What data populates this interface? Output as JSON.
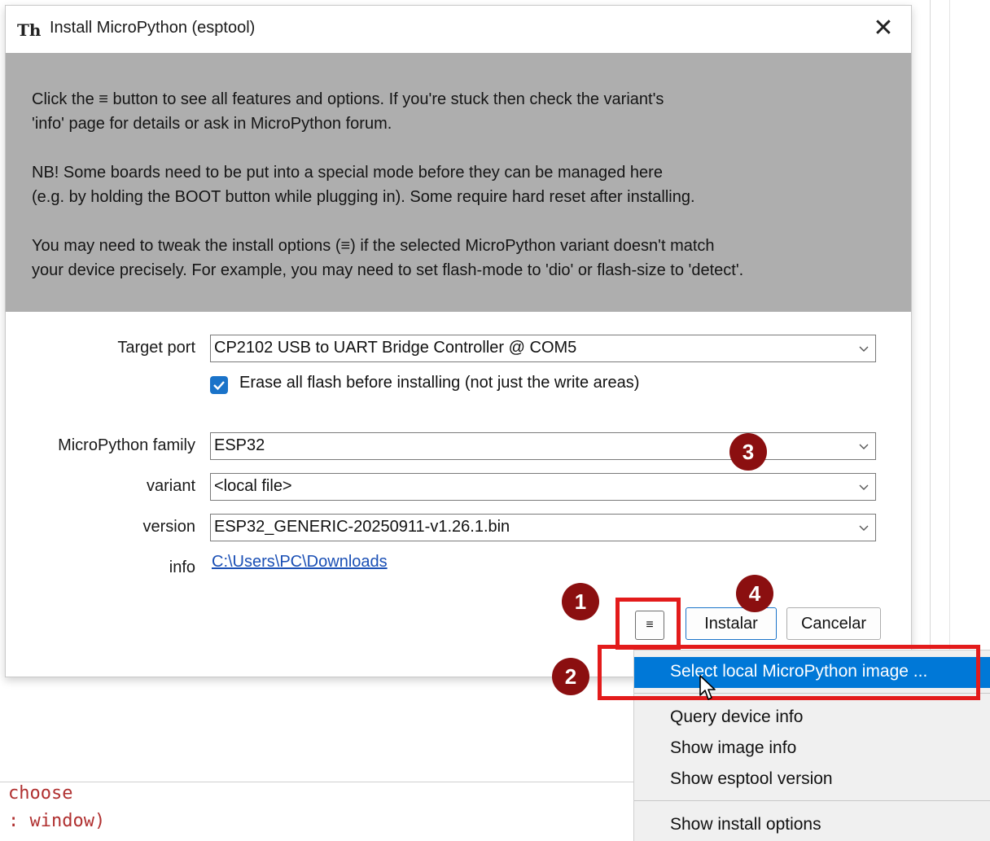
{
  "dialog": {
    "title": "Install MicroPython (esptool)",
    "close_glyph": "✕",
    "info_text": {
      "p1_line1": "Click the ≡ button to see all features and options. If you're stuck then check the variant's",
      "p1_line2": "'info' page for details or ask in MicroPython forum.",
      "p2_line1": "NB! Some boards need to be put into a special mode before they can be managed here",
      "p2_line2": "(e.g. by holding the BOOT button while plugging in). Some require hard reset after installing.",
      "p3_line1": "You may need to tweak the install options (≡) if the selected MicroPython variant doesn't match",
      "p3_line2": "your device precisely. For example, you may need to set flash-mode to 'dio' or flash-size to 'detect'."
    },
    "form": {
      "target_port_label": "Target port",
      "target_port_value": "CP2102 USB to UART Bridge Controller @ COM5",
      "erase_label": "Erase all flash before installing (not just the write areas)",
      "erase_checked": true,
      "family_label": "MicroPython family",
      "family_value": "ESP32",
      "variant_label": "variant",
      "variant_value": "<local file>",
      "version_label": "version",
      "version_value": "ESP32_GENERIC-20250911-v1.26.1.bin",
      "info_label": "info",
      "info_link": "C:\\Users\\PC\\Downloads"
    },
    "buttons": {
      "menu": "≡",
      "install": "Instalar",
      "cancel": "Cancelar"
    }
  },
  "menu": {
    "items": [
      "Select local MicroPython image ...",
      "Query device info",
      "Show image info",
      "Show esptool version",
      "Show install options"
    ]
  },
  "background_code": {
    "line1": "choose",
    "line2": ": window)"
  },
  "annotations": {
    "badge1": "1",
    "badge2": "2",
    "badge3": "3",
    "badge4": "4"
  },
  "colors": {
    "accent": "#0078d7",
    "annotation_red": "#e31b1b",
    "badge": "#8b0f10",
    "info_panel": "#aeaeae"
  }
}
